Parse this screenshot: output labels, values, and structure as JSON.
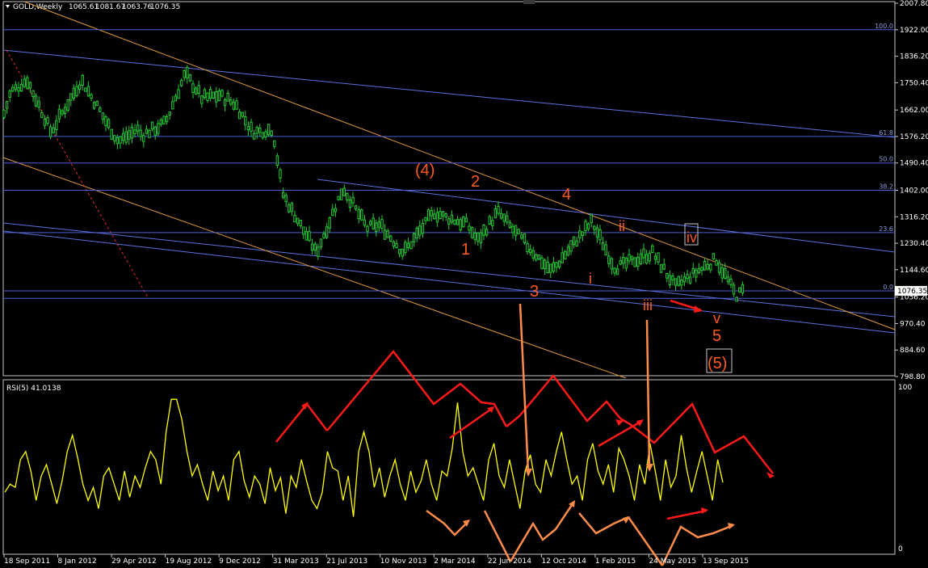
{
  "chart_data": {
    "type": "line",
    "header": {
      "symbol": "GOLD,Weekly",
      "open": "1065.61",
      "high": "1081.67",
      "low": "1063.76",
      "close": "1076.35"
    },
    "price_axis": {
      "ticks": [
        "2007.80",
        "1922.00",
        "1836.20",
        "1750.40",
        "1662.00",
        "1576.20",
        "1490.40",
        "1402.00",
        "1316.20",
        "1230.40",
        "1144.60",
        "1056.20",
        "970.40",
        "884.60",
        "798.80"
      ],
      "last_price": "1076.35",
      "ylim": [
        798.8,
        2007.8
      ]
    },
    "fib_levels": [
      {
        "label": "100.0",
        "price": 1922.0
      },
      {
        "label": "61.8",
        "price": 1576.2
      },
      {
        "label": "50.0",
        "price": 1490.4
      },
      {
        "label": "38.2",
        "price": 1402.0
      },
      {
        "label": "23.6",
        "price": 1265.0
      },
      {
        "label": "0.0",
        "price": 1076.35
      }
    ],
    "x_ticks": [
      "18 Sep 2011",
      "8 Jan 2012",
      "29 Apr 2012",
      "19 Aug 2012",
      "9 Dec 2012",
      "31 Mar 2013",
      "21 Jul 2013",
      "10 Nov 2013",
      "2 Mar 2014",
      "22 Jun 2014",
      "12 Oct 2014",
      "1 Feb 2015",
      "24 May 2015",
      "13 Sep 2015"
    ],
    "wave_labels": [
      "(4)",
      "2",
      "4",
      "1",
      "3",
      "ii",
      "i",
      "iii",
      "iv",
      "v",
      "5",
      "(5)"
    ],
    "price_series": {
      "name": "GOLD,Weekly",
      "keypoints": [
        {
          "x": "18 Sep 2011",
          "y": 1650
        },
        {
          "x": "2 Oct 2011",
          "y": 1720
        },
        {
          "x": "6 Nov 2011",
          "y": 1760
        },
        {
          "x": "25 Dec 2011",
          "y": 1590
        },
        {
          "x": "26 Feb 2012",
          "y": 1760
        },
        {
          "x": "13 May 2012",
          "y": 1560
        },
        {
          "x": "24 Jun 2012",
          "y": 1600
        },
        {
          "x": "1 Jul 2012",
          "y": 1580
        },
        {
          "x": "19 Aug 2012",
          "y": 1620
        },
        {
          "x": "30 Sep 2012",
          "y": 1780
        },
        {
          "x": "4 Nov 2012",
          "y": 1700
        },
        {
          "x": "9 Dec 2012",
          "y": 1710
        },
        {
          "x": "13 Jan 2013",
          "y": 1680
        },
        {
          "x": "17 Feb 2013",
          "y": 1590
        },
        {
          "x": "31 Mar 2013",
          "y": 1600
        },
        {
          "x": "21 Apr 2013",
          "y": 1390
        },
        {
          "x": "30 Jun 2013",
          "y": 1200
        },
        {
          "x": "25 Aug 2013",
          "y": 1410
        },
        {
          "x": "13 Oct 2013",
          "y": 1280
        },
        {
          "x": "10 Nov 2013",
          "y": 1290
        },
        {
          "x": "29 Dec 2013",
          "y": 1200
        },
        {
          "x": "2 Mar 2014",
          "y": 1330
        },
        {
          "x": "11 May 2014",
          "y": 1290
        },
        {
          "x": "1 Jun 2014",
          "y": 1240
        },
        {
          "x": "13 Jul 2014",
          "y": 1330
        },
        {
          "x": "14 Sep 2014",
          "y": 1220
        },
        {
          "x": "2 Nov 2014",
          "y": 1140
        },
        {
          "x": "25 Jan 2015",
          "y": 1300
        },
        {
          "x": "15 Mar 2015",
          "y": 1150
        },
        {
          "x": "31 May 2015",
          "y": 1200
        },
        {
          "x": "19 Jul 2015",
          "y": 1090
        },
        {
          "x": "11 Oct 2015",
          "y": 1180
        },
        {
          "x": "22 Nov 2015",
          "y": 1060
        },
        {
          "x": "6 Dec 2015",
          "y": 1076
        }
      ]
    },
    "rsi": {
      "label": "RSI(5) 41.0138",
      "ticks": [
        "100",
        "0"
      ],
      "ylim": [
        0,
        100
      ],
      "values": [
        35,
        40,
        38,
        55,
        60,
        48,
        30,
        45,
        52,
        40,
        28,
        42,
        60,
        70,
        56,
        40,
        30,
        38,
        25,
        45,
        50,
        40,
        30,
        48,
        32,
        45,
        38,
        50,
        60,
        55,
        40,
        72,
        92,
        92,
        80,
        60,
        45,
        52,
        40,
        30,
        48,
        36,
        45,
        30,
        55,
        60,
        42,
        32,
        45,
        40,
        28,
        50,
        36,
        44,
        22,
        45,
        38,
        55,
        42,
        30,
        25,
        35,
        60,
        50,
        48,
        30,
        45,
        20,
        60,
        72,
        60,
        38,
        50,
        32,
        45,
        55,
        40,
        30,
        48,
        35,
        42,
        55,
        40,
        30,
        48,
        45,
        62,
        90,
        60,
        45,
        50,
        40,
        30,
        55,
        65,
        45,
        38,
        55,
        40,
        25,
        48,
        58,
        40,
        35,
        55,
        45,
        60,
        72,
        55,
        40,
        45,
        30,
        55,
        65,
        48,
        40,
        52,
        35,
        62,
        55,
        45,
        30,
        52,
        40,
        65,
        48,
        30,
        55,
        38,
        45,
        70,
        50,
        35,
        48,
        60,
        45,
        30,
        55,
        41
      ]
    },
    "grid": false,
    "xlabel": "",
    "ylabel": ""
  }
}
